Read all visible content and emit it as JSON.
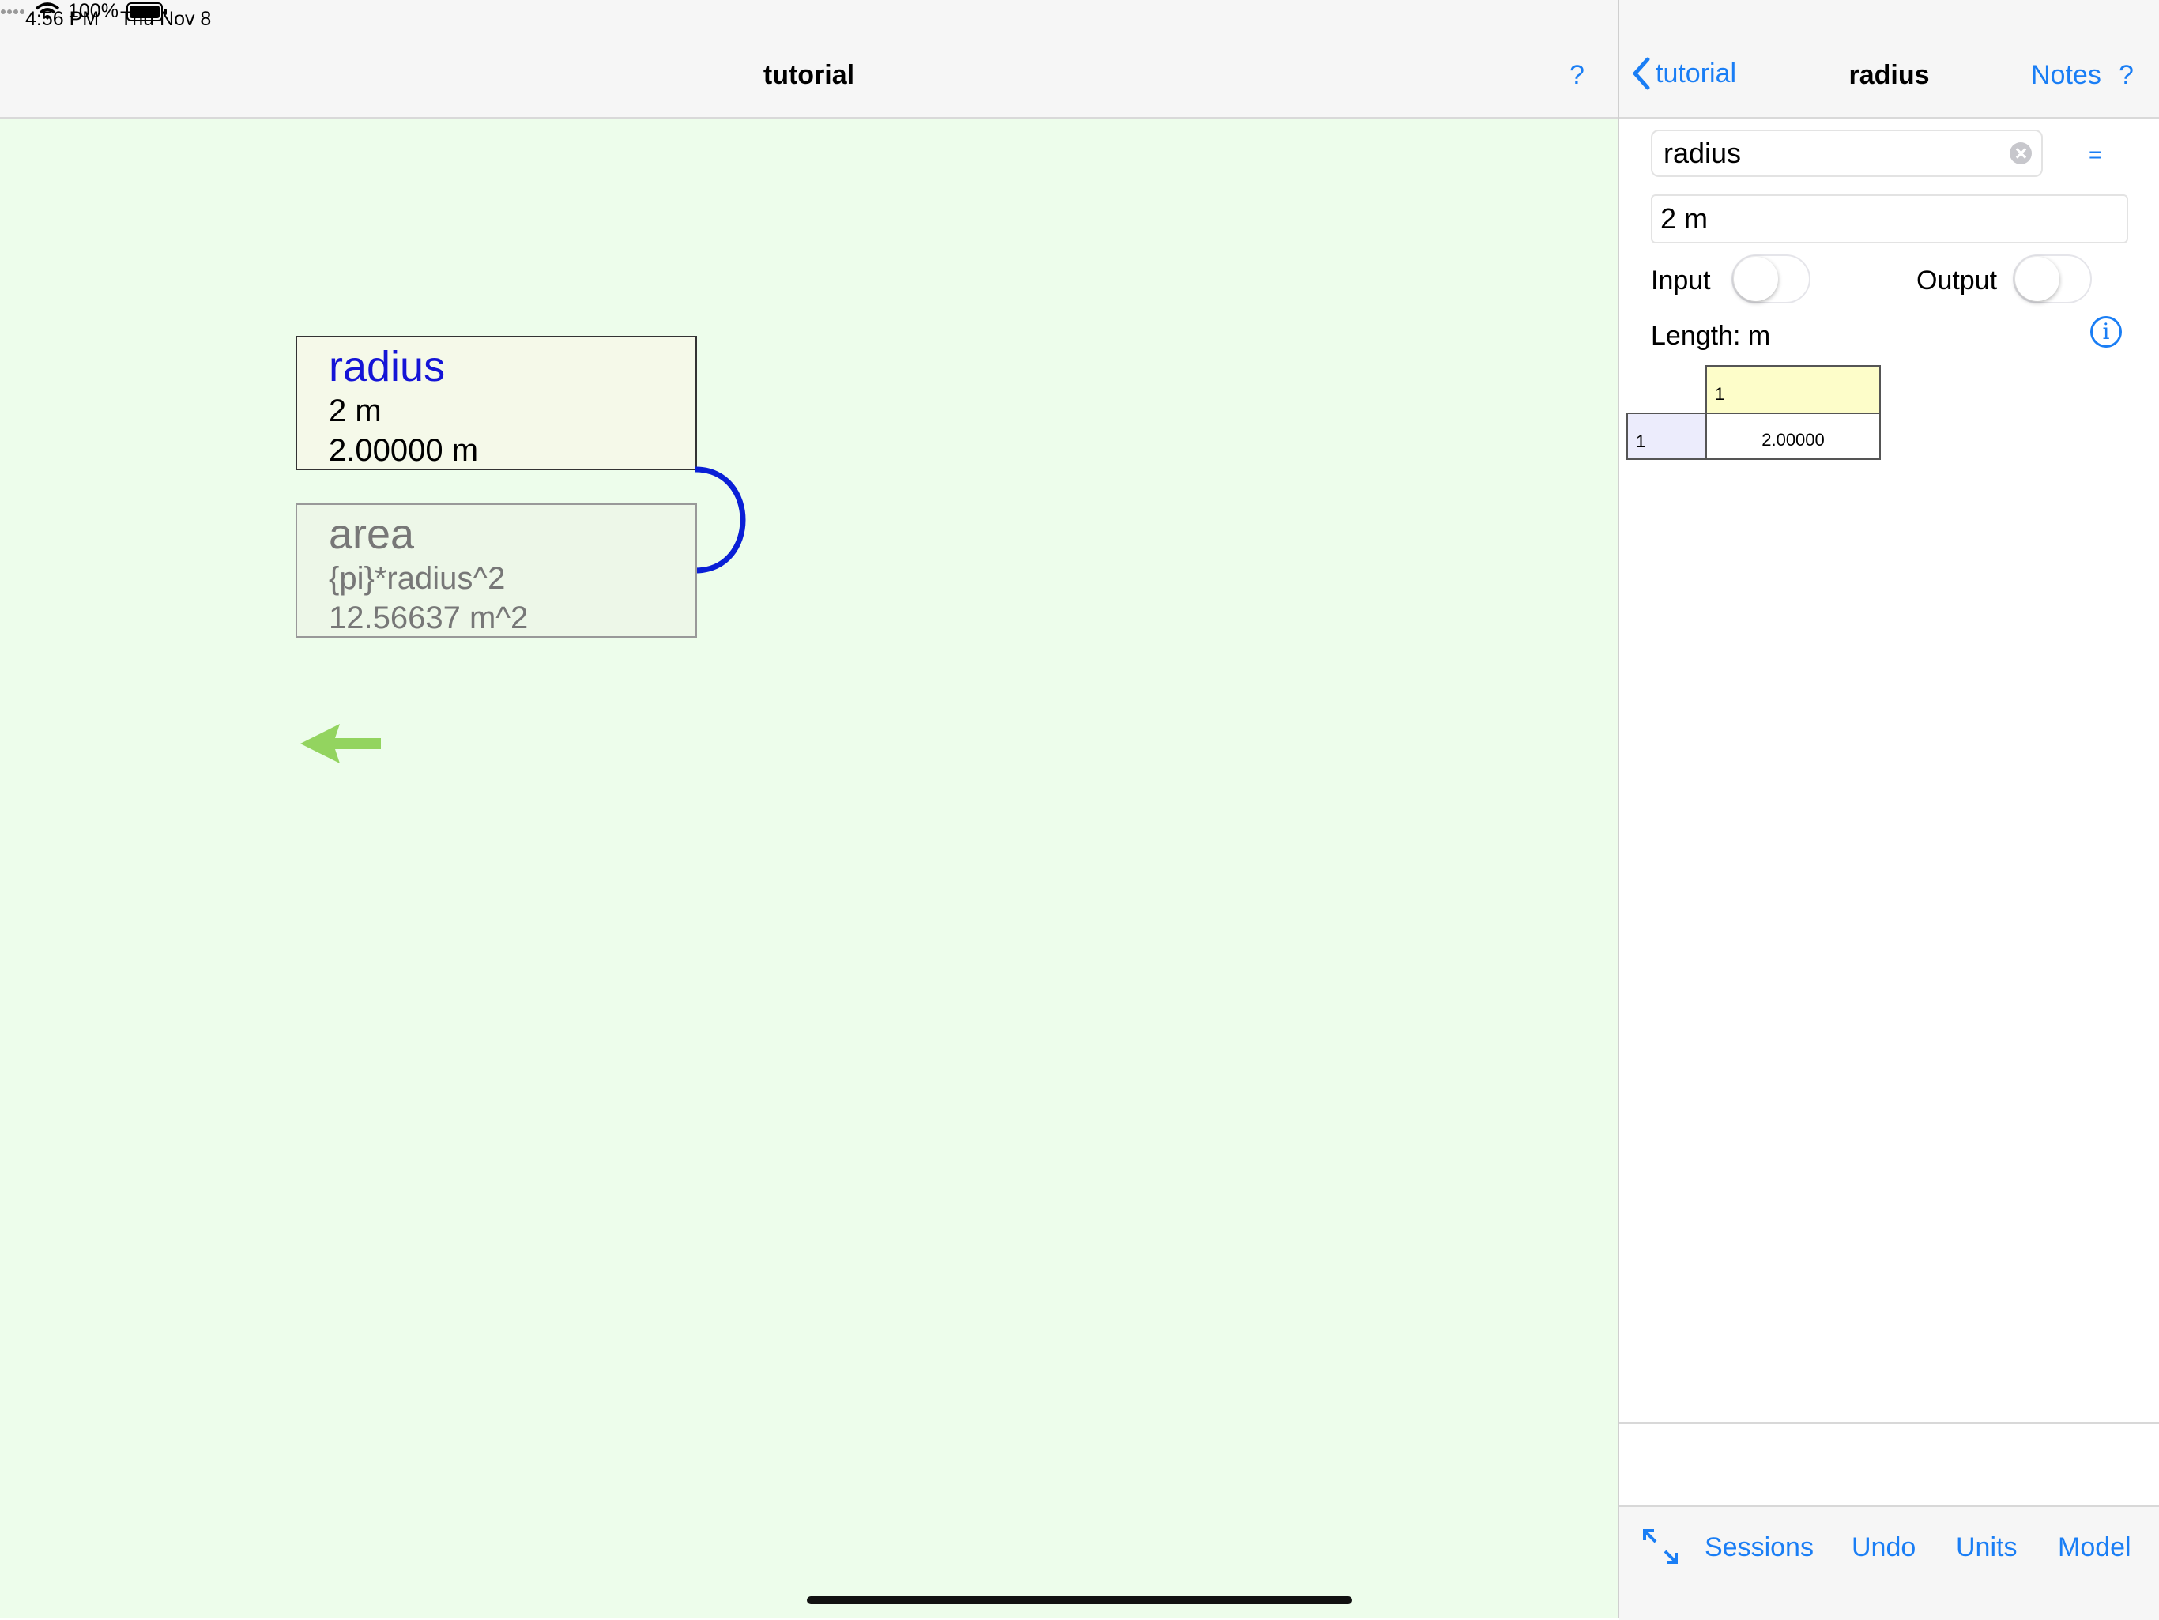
{
  "status_bar": {
    "time": "4:56 PM",
    "date": "Thu Nov 8",
    "battery": "100%"
  },
  "left": {
    "title": "tutorial",
    "help": "?",
    "nodes": {
      "radius": {
        "name": "radius",
        "expression": "2 m",
        "value": "2.00000 m"
      },
      "area": {
        "name": "area",
        "expression": "{pi}*radius^2",
        "value": "12.56637 m^2"
      }
    }
  },
  "right": {
    "back_label": "tutorial",
    "title": "radius",
    "notes_label": "Notes",
    "help": "?",
    "name_value": "radius",
    "equals_label": "=",
    "value": "2 m",
    "input_label": "Input",
    "output_label": "Output",
    "input_on": false,
    "output_on": false,
    "units_label": "Length: m",
    "info_icon": "i",
    "grid": {
      "col_header": "1",
      "row_header": "1",
      "cell": "2.00000"
    },
    "toolbar": {
      "sessions": "Sessions",
      "undo": "Undo",
      "units": "Units",
      "model": "Model"
    }
  },
  "colors": {
    "accent": "#1a7ef5",
    "canvas_bg": "#edfdeb",
    "node_name_active": "#1414d6",
    "connector": "#0a1fd6",
    "back_arrow": "#93d45f"
  }
}
